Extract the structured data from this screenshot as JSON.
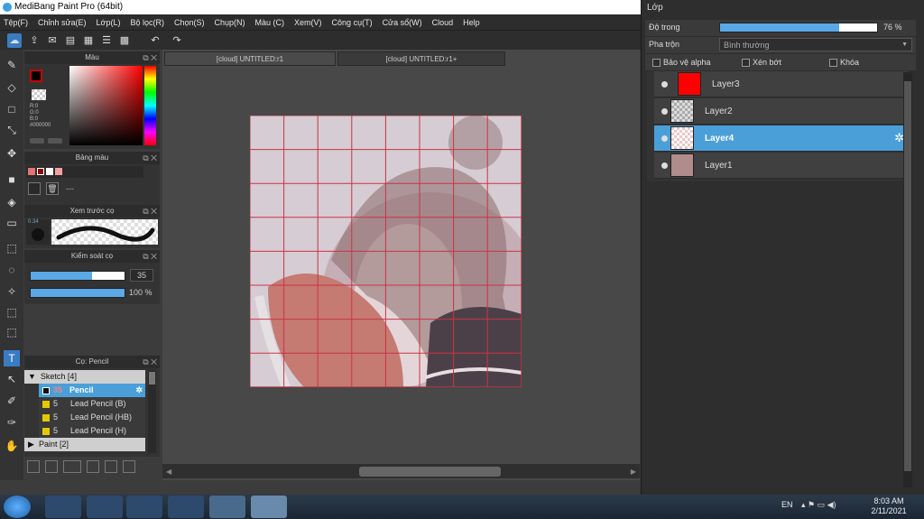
{
  "app": {
    "title": "MediBang Paint Pro (64bit)"
  },
  "menu": [
    "Tệp(F)",
    "Chỉnh sửa(E)",
    "Lớp(L)",
    "Bộ lọc(R)",
    "Chọn(S)",
    "Chụp(N)",
    "Màu (C)",
    "Xem(V)",
    "Công cụ(T)",
    "Cửa sổ(W)",
    "Cloud",
    "Help"
  ],
  "tabs": [
    "[cloud] UNTITLED:r1",
    "[cloud] UNTITLED:r1+"
  ],
  "color_panel": {
    "title": "Màu",
    "r": "R:0",
    "g": "G:0",
    "b": "B:0",
    "hex": "#000000"
  },
  "palette_panel": {
    "title": "Bảng màu",
    "dash": "---"
  },
  "preview_panel": {
    "title": "Xem trước cọ",
    "size": "0.34"
  },
  "control_panel": {
    "title": "Kiểm soát cọ",
    "size_value": "35",
    "opacity_value": "100 %",
    "size_fraction": 0.65,
    "opacity_fraction": 1.0
  },
  "brush_panel": {
    "title": "Cọ: Pencil",
    "groups": [
      {
        "label": "Sketch [4]",
        "items": [
          {
            "size": "35",
            "name": "Pencil",
            "selected": true
          },
          {
            "size": "5",
            "name": "Lead Pencil (B)"
          },
          {
            "size": "5",
            "name": "Lead Pencil (HB)"
          },
          {
            "size": "5",
            "name": "Lead Pencil (H)"
          }
        ]
      },
      {
        "label": "Paint [2]"
      }
    ]
  },
  "layers_panel": {
    "title": "Lớp",
    "opacity_label": "Độ trong",
    "opacity_value": "76 %",
    "opacity_fraction": 0.76,
    "blend_label": "Pha trộn",
    "blend_value": "Bình thường",
    "protect_alpha": "Bảo vệ alpha",
    "clip": "Xén bớt",
    "lock": "Khóa",
    "layers": [
      "Layer3",
      "Layer2",
      "Layer4",
      "Layer1"
    ],
    "selected": "Layer4"
  },
  "taskbar": {
    "lang": "EN",
    "time": "8:03 AM",
    "date": "2/11/2021"
  },
  "colors": {
    "accent": "#4a9fd8",
    "selected_layer": "#4a9fd8",
    "layer3_thumb": "#ff0000",
    "grid": "#cc3344"
  }
}
